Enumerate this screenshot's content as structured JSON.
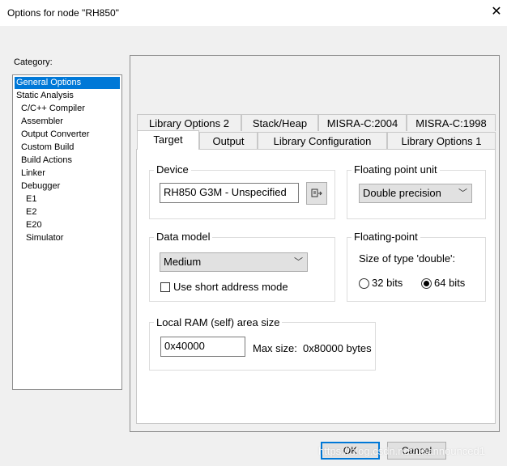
{
  "window": {
    "title": "Options for node \"RH850\"",
    "close_glyph": "✕"
  },
  "category": {
    "label": "Category:",
    "items": [
      {
        "label": "General Options"
      },
      {
        "label": "Static Analysis"
      },
      {
        "label": "C/C++ Compiler"
      },
      {
        "label": "Assembler"
      },
      {
        "label": "Output Converter"
      },
      {
        "label": "Custom Build"
      },
      {
        "label": "Build Actions"
      },
      {
        "label": "Linker"
      },
      {
        "label": "Debugger"
      },
      {
        "label": "E1"
      },
      {
        "label": "E2"
      },
      {
        "label": "E20"
      },
      {
        "label": "Simulator"
      }
    ],
    "selected": "General Options"
  },
  "tabs": {
    "row_back": [
      "Library Options 2",
      "Stack/Heap",
      "MISRA-C:2004",
      "MISRA-C:1998"
    ],
    "row_front": [
      "Target",
      "Output",
      "Library Configuration",
      "Library Options 1"
    ],
    "active": "Target"
  },
  "device": {
    "group_title": "Device",
    "value": "RH850 G3M - Unspecified",
    "browse_icon": "device-select-icon"
  },
  "fpu": {
    "group_title": "Floating point unit",
    "selected": "Double precision"
  },
  "data_model": {
    "group_title": "Data model",
    "selected": "Medium",
    "short_address_label": "Use short address mode",
    "short_address_checked": false
  },
  "floating_point": {
    "group_title": "Floating-point",
    "size_label": "Size of type 'double':",
    "option_32": "32 bits",
    "option_64": "64 bits",
    "selected": "64 bits"
  },
  "local_ram": {
    "group_title": "Local RAM (self) area size",
    "value": "0x40000",
    "max_label": "Max size:",
    "max_value": "0x80000 bytes"
  },
  "buttons": {
    "ok": "OK",
    "cancel": "Cancel"
  },
  "watermark": "https://blog.csdn.net/unannounced1"
}
